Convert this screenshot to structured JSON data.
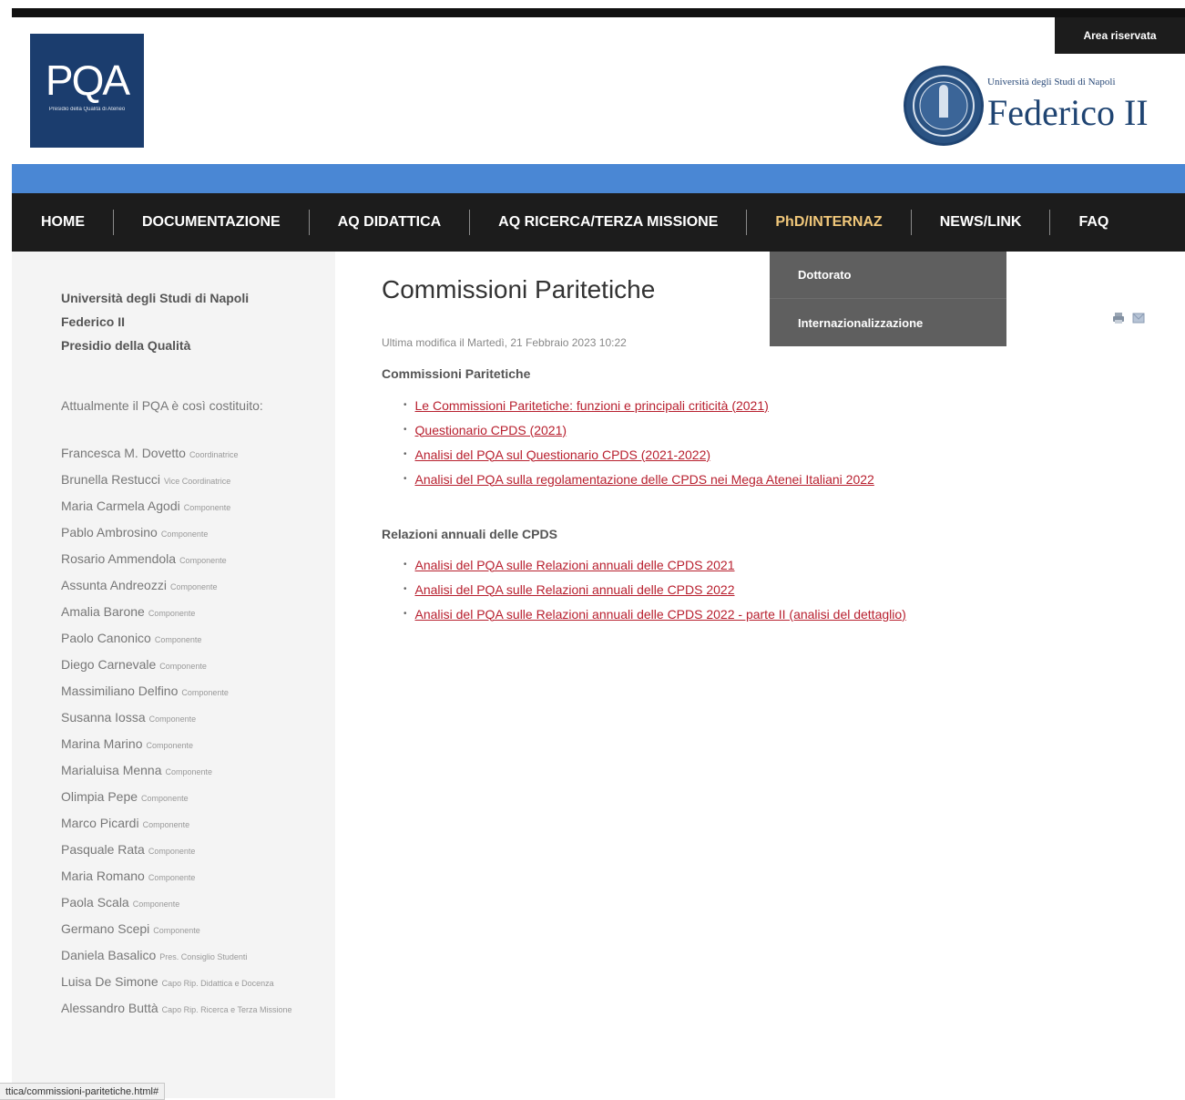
{
  "header": {
    "reserved_area": "Area riservata",
    "pqa_logo_text": "PQA",
    "pqa_logo_subtext": "Presidio della Qualità di Ateneo",
    "federico_subtitle": "Università degli Studi di Napoli",
    "federico_title": "Federico II"
  },
  "nav": {
    "items": [
      "HOME",
      "DOCUMENTAZIONE",
      "AQ DIDATTICA",
      "AQ RICERCA/TERZA MISSIONE",
      "PhD/INTERNAZ",
      "NEWS/LINK",
      "FAQ"
    ],
    "active": "PhD/INTERNAZ",
    "dropdown": [
      "Dottorato",
      "Internazionalizzazione"
    ]
  },
  "sidebar": {
    "title_lines": [
      "Università degli Studi di Napoli",
      "Federico II",
      "Presidio della Qualità"
    ],
    "intro": "Attualmente il PQA è così costituito:",
    "members": [
      {
        "name": "Francesca M. Dovetto",
        "role": "Coordinatrice"
      },
      {
        "name": "Brunella Restucci",
        "role": "Vice Coordinatrice"
      },
      {
        "name": "Maria Carmela Agodi",
        "role": "Componente"
      },
      {
        "name": "Pablo Ambrosino",
        "role": "Componente"
      },
      {
        "name": "Rosario Ammendola",
        "role": "Componente"
      },
      {
        "name": "Assunta Andreozzi",
        "role": "Componente"
      },
      {
        "name": "Amalia Barone",
        "role": "Componente"
      },
      {
        "name": "Paolo Canonico",
        "role": "Componente"
      },
      {
        "name": "Diego Carnevale",
        "role": "Componente"
      },
      {
        "name": "Massimiliano Delfino",
        "role": "Componente"
      },
      {
        "name": "Susanna Iossa",
        "role": "Componente"
      },
      {
        "name": "Marina Marino",
        "role": "Componente"
      },
      {
        "name": "Marialuisa Menna",
        "role": "Componente"
      },
      {
        "name": "Olimpia Pepe",
        "role": "Componente"
      },
      {
        "name": "Marco Picardi",
        "role": "Componente"
      },
      {
        "name": "Pasquale Rata",
        "role": "Componente"
      },
      {
        "name": "Maria Romano",
        "role": "Componente"
      },
      {
        "name": "Paola Scala",
        "role": "Componente"
      },
      {
        "name": "Germano Scepi",
        "role": "Componente"
      },
      {
        "name": "Daniela Basalico",
        "role": "Pres. Consiglio Studenti"
      },
      {
        "name": "Luisa De Simone",
        "role": "Capo Rip. Didattica e Docenza"
      },
      {
        "name": "Alessandro Buttà",
        "role": "Capo Rip. Ricerca e Terza Missione"
      }
    ]
  },
  "content": {
    "title": "Commissioni Paritetiche",
    "last_modified": "Ultima modifica il Martedì, 21 Febbraio 2023 10:22",
    "section1_title": "Commissioni Paritetiche",
    "section1_links": [
      "Le Commissioni Paritetiche: funzioni e principali criticità (2021)",
      "Questionario CPDS (2021)",
      "Analisi del PQA sul Questionario CPDS (2021-2022)",
      "Analisi del PQA sulla regolamentazione delle CPDS nei Mega Atenei Italiani 2022"
    ],
    "section2_title": "Relazioni annuali delle CPDS",
    "section2_links": [
      "Analisi del PQA sulle Relazioni annuali delle CPDS 2021",
      "Analisi del PQA sulle Relazioni annuali delle CPDS 2022",
      "Analisi del PQA sulle Relazioni annuali delle CPDS 2022 - parte II (analisi del dettaglio)"
    ]
  },
  "status_bar": {
    "url": "ttica/commissioni-paritetiche.html#"
  }
}
